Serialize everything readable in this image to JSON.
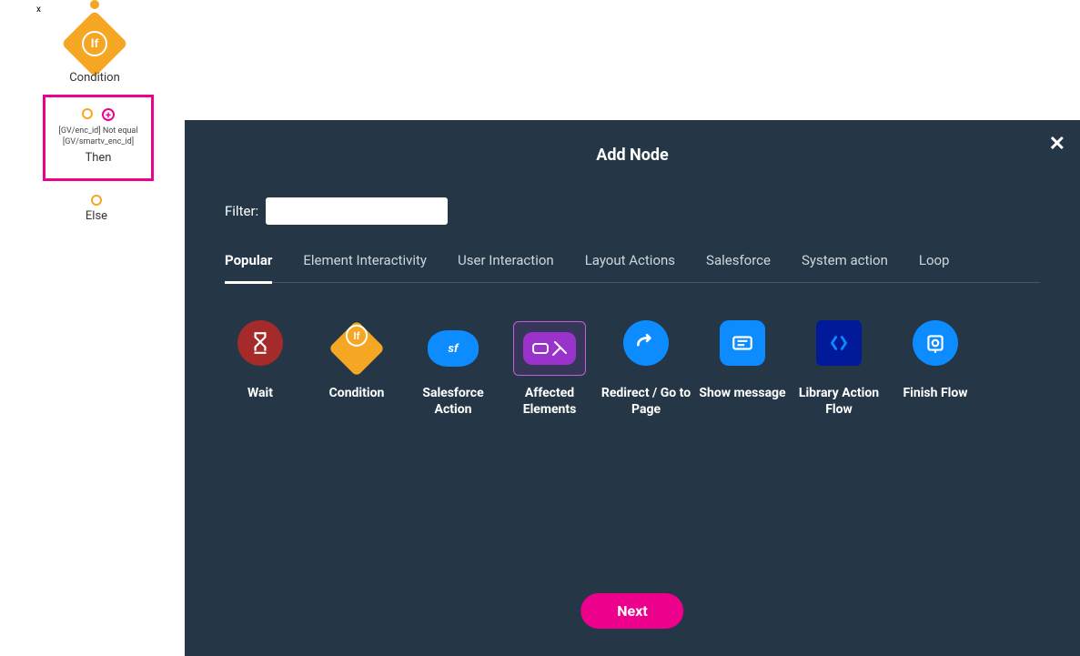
{
  "flow": {
    "condition_label": "Condition",
    "condition_glyph": "If",
    "then_expression": "[GV/enc_id] Not equal [GV/smartv_enc_id]",
    "then_label": "Then",
    "else_label": "Else",
    "x_glyph": "x"
  },
  "modal": {
    "title": "Add Node",
    "filter_label": "Filter:",
    "filter_value": "",
    "filter_placeholder": "",
    "next_label": "Next",
    "close_glyph": "✕"
  },
  "tabs": [
    {
      "label": "Popular",
      "active": true
    },
    {
      "label": "Element Interactivity",
      "active": false
    },
    {
      "label": "User Interaction",
      "active": false
    },
    {
      "label": "Layout Actions",
      "active": false
    },
    {
      "label": "Salesforce",
      "active": false
    },
    {
      "label": "System action",
      "active": false
    },
    {
      "label": "Loop",
      "active": false
    }
  ],
  "nodes": [
    {
      "name": "wait",
      "label": "Wait",
      "icon": "wait-icon",
      "color": "#a52a2a",
      "selected": false
    },
    {
      "name": "condition",
      "label": "Condition",
      "icon": "condition-icon",
      "color": "#f5a623",
      "selected": false
    },
    {
      "name": "salesforce-action",
      "label": "Salesforce Action",
      "icon": "cloud-icon",
      "color": "#0d8cff",
      "selected": false
    },
    {
      "name": "affected-elements",
      "label": "Affected Elements",
      "icon": "elements-icon",
      "color": "#9933cc",
      "selected": true
    },
    {
      "name": "redirect",
      "label": "Redirect / Go to Page",
      "icon": "redirect-icon",
      "color": "#0d8cff",
      "selected": false
    },
    {
      "name": "show-message",
      "label": "Show message",
      "icon": "message-icon",
      "color": "#0d8cff",
      "selected": false
    },
    {
      "name": "library-action-flow",
      "label": "Library Action Flow",
      "icon": "library-icon",
      "color": "#001a99",
      "selected": false
    },
    {
      "name": "finish-flow",
      "label": "Finish Flow",
      "icon": "finish-icon",
      "color": "#0d8cff",
      "selected": false
    }
  ]
}
